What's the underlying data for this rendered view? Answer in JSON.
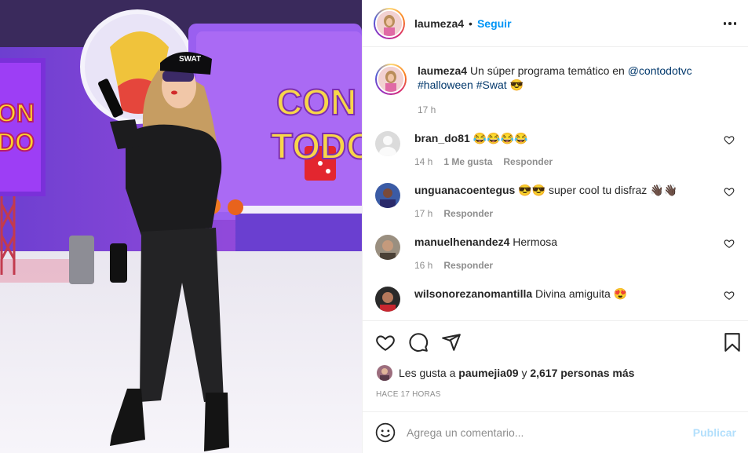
{
  "post": {
    "username": "laumeza4",
    "dot": "•",
    "follow_label": "Seguir"
  },
  "caption": {
    "username": "laumeza4",
    "text": "Un súper programa temático en",
    "mention": "@contodotvc",
    "hashtag1": "#halloween",
    "hashtag2": "#Swat",
    "emoji": "😎",
    "time": "17 h"
  },
  "photo": {
    "sign_line1": "CON",
    "sign_line2": "TODO",
    "left_sign_line1": "ON",
    "left_sign_line2": "DO",
    "cap_text": "SWAT"
  },
  "comments": [
    {
      "username": "bran_do81",
      "text": "😂😂😂😂",
      "time": "14 h",
      "likes": "1 Me gusta",
      "reply": "Responder",
      "avatar": "avatar-gray"
    },
    {
      "username": "unguanacoentegus",
      "text": "😎😎 super cool tu disfraz 👋🏿👋🏿",
      "time": "17 h",
      "reply": "Responder",
      "avatar": "avatar-blue"
    },
    {
      "username": "manuelhenandez4",
      "text": "Hermosa",
      "time": "16 h",
      "reply": "Responder",
      "avatar": "avatar-brown"
    },
    {
      "username": "wilsonorezanomantilla",
      "text": "Divina amiguita 😍",
      "avatar": "avatar-dark"
    }
  ],
  "likes": {
    "prefix": "Les gusta a",
    "user": "paumejia09",
    "middle": "y",
    "count": "2,617 personas más"
  },
  "time_ago": "HACE 17 HORAS",
  "add_comment": {
    "placeholder": "Agrega un comentario...",
    "post_label": "Publicar"
  },
  "colors": {
    "link": "#0095f6",
    "mention": "#00376b",
    "muted": "#8e8e8e",
    "publish_disabled": "#b2dffc"
  }
}
